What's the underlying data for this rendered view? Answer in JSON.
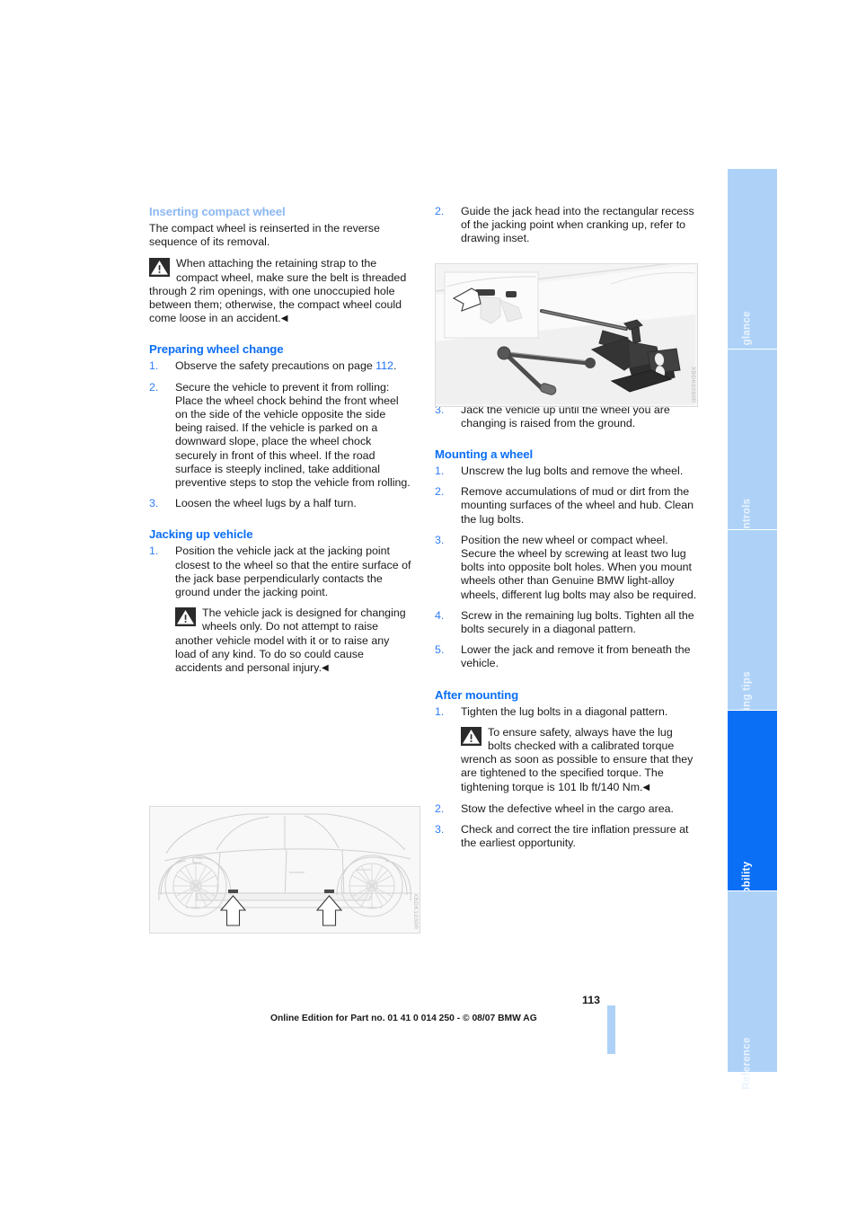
{
  "document": {
    "page_number": "113",
    "footer_note": "Online Edition for Part no. 01 41 0 014 250 - © 08/07 BMW AG"
  },
  "chapter_tabs": [
    {
      "label": "At a glance",
      "active": false
    },
    {
      "label": "Controls",
      "active": false
    },
    {
      "label": "Driving tips",
      "active": false
    },
    {
      "label": "Mobility",
      "active": true
    },
    {
      "label": "Reference",
      "active": false
    }
  ],
  "colors": {
    "heading_blue": "#0b6ef5",
    "heading_blue_faded": "#8cb8f2",
    "list_number_blue": "#2f7df6",
    "tab_inactive": "#aed2f7",
    "tab_active": "#0b6ff5",
    "xref_blue": "#1c6ef5",
    "body_text": "#1a1a1a"
  },
  "left_column": {
    "section_inserting": {
      "heading": "Inserting compact wheel",
      "paragraph": "The compact wheel is reinserted in the reverse sequence of its removal.",
      "warning": {
        "icon": "warning-triangle-icon",
        "text": "When attaching the retaining strap to the compact wheel, make sure the belt is threaded through 2 rim openings, with one unoccupied hole between them; otherwise, the compact wheel could come loose in an accident.",
        "endmark": "◀"
      }
    },
    "section_preparing": {
      "heading": "Preparing wheel change",
      "steps": [
        {
          "num": "1.",
          "text_before": "Observe the safety precautions on page ",
          "xref": "112",
          "text_after": "."
        },
        {
          "num": "2.",
          "text": "Secure the vehicle to prevent it from rolling: Place the wheel chock behind the front wheel on the side of the vehicle opposite the side being raised. If the vehicle is parked on a downward slope, place the wheel chock securely in front of this wheel. If the road surface is steeply inclined, take additional preventive steps to stop the vehicle from rolling."
        },
        {
          "num": "3.",
          "text": "Loosen the wheel lugs by a half turn."
        }
      ]
    },
    "section_jacking": {
      "heading": "Jacking up vehicle",
      "steps": [
        {
          "num": "1.",
          "text": "Position the vehicle jack at the jacking point closest to the wheel so that the entire surface of the jack base perpendicularly contacts the ground under the jacking point."
        }
      ],
      "warning": {
        "icon": "warning-triangle-icon",
        "text": "The vehicle jack is designed for changing wheels only. Do not attempt to raise another vehicle model with it or to raise any load of any kind. To do so could cause accidents and personal injury.",
        "endmark": "◀"
      },
      "figure": {
        "name": "vehicle-side-view-jacking-points-illustration",
        "code": "XBDK1030R"
      }
    }
  },
  "right_column": {
    "jacking_continued": {
      "steps": [
        {
          "num": "2.",
          "text": "Guide the jack head into the rectangular recess of the jacking point when cranking up, refer to drawing inset."
        }
      ],
      "figure": {
        "name": "vehicle-jack-illustration",
        "code": "XBDK0260R"
      },
      "steps_after": [
        {
          "num": "3.",
          "text": "Jack the vehicle up until the wheel you are changing is raised from the ground."
        }
      ]
    },
    "section_mounting": {
      "heading": "Mounting a wheel",
      "steps": [
        {
          "num": "1.",
          "text": "Unscrew the lug bolts and remove the wheel."
        },
        {
          "num": "2.",
          "text": "Remove accumulations of mud or dirt from the mounting surfaces of the wheel and hub. Clean the lug bolts."
        },
        {
          "num": "3.",
          "text": "Position the new wheel or compact wheel. Secure the wheel by screwing at least two lug bolts into opposite bolt holes. When you mount wheels other than Genuine BMW light-alloy wheels, different lug bolts may also be required."
        },
        {
          "num": "4.",
          "text": "Screw in the remaining lug bolts. Tighten all the bolts securely in a diagonal pattern."
        },
        {
          "num": "5.",
          "text": "Lower the jack and remove it from beneath the vehicle."
        }
      ]
    },
    "section_after": {
      "heading": "After mounting",
      "step1": {
        "num": "1.",
        "text": "Tighten the lug bolts in a diagonal pattern."
      },
      "warning": {
        "icon": "warning-triangle-icon",
        "text": "To ensure safety, always have the lug bolts checked with a calibrated torque wrench as soon as possible to ensure that they are tightened to the specified torque. The tightening torque is 101 lb ft/140 Nm.",
        "endmark": "◀"
      },
      "steps_rest": [
        {
          "num": "2.",
          "text": "Stow the defective wheel in the cargo area."
        },
        {
          "num": "3.",
          "text": "Check and correct the tire inflation pressure at the earliest opportunity."
        }
      ]
    }
  }
}
